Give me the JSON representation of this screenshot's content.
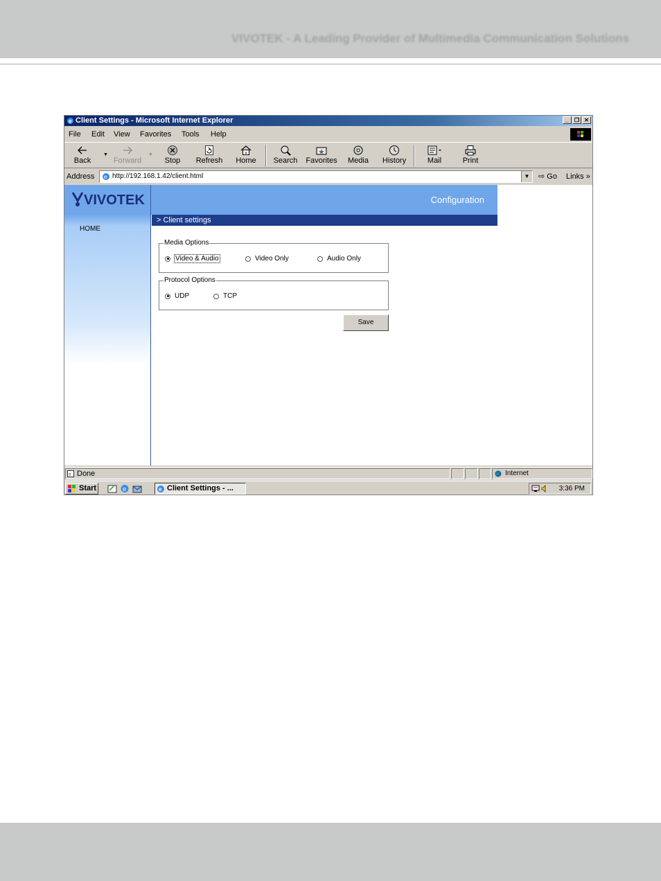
{
  "page": {
    "header_text": "VIVOTEK - A Leading Provider of Multimedia Communication Solutions"
  },
  "window": {
    "title": "Client Settings - Microsoft Internet Explorer",
    "controls": [
      "_",
      "❐",
      "✕"
    ]
  },
  "menu": [
    {
      "label": "File"
    },
    {
      "label": "Edit"
    },
    {
      "label": "View"
    },
    {
      "label": "Favorites"
    },
    {
      "label": "Tools"
    },
    {
      "label": "Help"
    }
  ],
  "toolbar": {
    "back": "Back",
    "forward": "Forward",
    "stop": "Stop",
    "refresh": "Refresh",
    "home": "Home",
    "search": "Search",
    "favorites": "Favorites",
    "media": "Media",
    "history": "History",
    "mail": "Mail",
    "print": "Print"
  },
  "address": {
    "label": "Address",
    "url": "http://192.168.1.42/client.html",
    "go": "Go",
    "links": "Links »"
  },
  "app": {
    "logo_text": "VIVOTEK",
    "banner_title": "Configuration",
    "nav_home": "HOME",
    "breadcrumb": "> Client settings",
    "media_options": {
      "legend": "Media Options",
      "options": [
        "Video & Audio",
        "Video Only",
        "Audio Only"
      ],
      "selected": "Video & Audio"
    },
    "protocol_options": {
      "legend": "Protocol Options",
      "options": [
        "UDP",
        "TCP"
      ],
      "selected": "UDP"
    },
    "save_label": "Save"
  },
  "status": {
    "text": "Done",
    "zone": "Internet"
  },
  "taskbar": {
    "start": "Start",
    "task": "Client Settings - ...",
    "clock": "3:36 PM"
  },
  "colors": {
    "titlebar": "#0a246a",
    "banner": "#6fa6ea",
    "breadcrumb": "#1e3e8c",
    "chrome": "#d4d0c8"
  }
}
